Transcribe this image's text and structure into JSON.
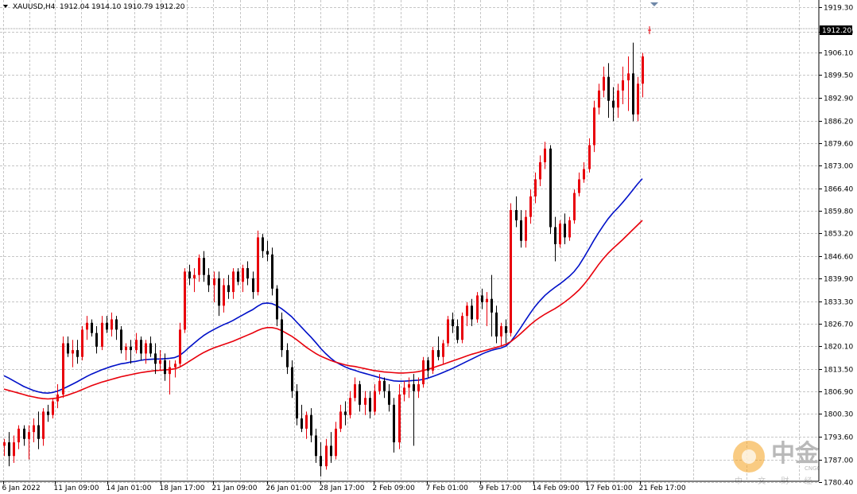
{
  "header": {
    "symbol": "XAUUSD,H4",
    "ohlc": "1912.04 1914.10 1910.79 1912.20"
  },
  "price_label": "1912.20",
  "watermark": {
    "logo_text": "中金网",
    "logo_sub": "CNGOLD.COM",
    "tagline": "中 文 财 经 新 媒 体"
  },
  "colors": {
    "bull": "#e8000b",
    "bear": "#000000",
    "ma_fast": "#0010c8",
    "ma_slow": "#e8000b",
    "grid": "#c6c6c6",
    "price_box": "#000000"
  },
  "chart_data": {
    "type": "candlestick",
    "symbol": "XAUUSD",
    "timeframe": "H4",
    "ylim": [
      1780.6,
      1921.5
    ],
    "y_ticks": [
      "1919.30",
      "1912.20",
      "1906.10",
      "1899.50",
      "1892.90",
      "1886.20",
      "1879.60",
      "1873.00",
      "1866.40",
      "1859.80",
      "1853.20",
      "1846.60",
      "1839.90",
      "1833.30",
      "1826.70",
      "1820.10",
      "1813.50",
      "1806.90",
      "1800.30",
      "1793.60",
      "1787.00",
      "1780.40"
    ],
    "x_ticks": [
      "6 Jan 2022",
      "11 Jan 09:00",
      "14 Jan 01:00",
      "18 Jan 17:00",
      "21 Jan 09:00",
      "26 Jan 01:00",
      "28 Jan 17:00",
      "2 Feb 09:00",
      "7 Feb 01:00",
      "9 Feb 17:00",
      "14 Feb 09:00",
      "17 Feb 01:00",
      "21 Feb 17:00"
    ],
    "current_price": 1912.2,
    "series": [
      {
        "name": "",
        "kind": "candles",
        "ohlc": [
          [
            1791,
            1793,
            1788,
            1792
          ],
          [
            1792,
            1795,
            1785,
            1788
          ],
          [
            1788,
            1794,
            1786,
            1792
          ],
          [
            1792,
            1797,
            1790,
            1796
          ],
          [
            1796,
            1797,
            1791,
            1793
          ],
          [
            1793,
            1797,
            1787,
            1795
          ],
          [
            1795,
            1799,
            1792,
            1797
          ],
          [
            1797,
            1801,
            1790,
            1793
          ],
          [
            1793,
            1802,
            1791,
            1801
          ],
          [
            1801,
            1803,
            1798,
            1800
          ],
          [
            1800,
            1805,
            1799,
            1804
          ],
          [
            1804,
            1809,
            1802,
            1806
          ],
          [
            1806,
            1823,
            1805,
            1821
          ],
          [
            1821,
            1823,
            1817,
            1818
          ],
          [
            1818,
            1822,
            1814,
            1819
          ],
          [
            1819,
            1822,
            1815,
            1817
          ],
          [
            1817,
            1826,
            1816,
            1825
          ],
          [
            1825,
            1829,
            1822,
            1827
          ],
          [
            1827,
            1828,
            1823,
            1824
          ],
          [
            1824,
            1826,
            1818,
            1820
          ],
          [
            1820,
            1829,
            1819,
            1827
          ],
          [
            1827,
            1829,
            1824,
            1825
          ],
          [
            1825,
            1830,
            1823,
            1828
          ],
          [
            1828,
            1829,
            1822,
            1825
          ],
          [
            1825,
            1826,
            1818,
            1819
          ],
          [
            1819,
            1821,
            1816,
            1820
          ],
          [
            1820,
            1822,
            1815,
            1819
          ],
          [
            1819,
            1824,
            1818,
            1822
          ],
          [
            1822,
            1823,
            1816,
            1818
          ],
          [
            1818,
            1822,
            1815,
            1821
          ],
          [
            1821,
            1823,
            1817,
            1818
          ],
          [
            1818,
            1821,
            1812,
            1815
          ],
          [
            1815,
            1819,
            1813,
            1816
          ],
          [
            1816,
            1818,
            1810,
            1812
          ],
          [
            1812,
            1816,
            1806,
            1814
          ],
          [
            1814,
            1816,
            1811,
            1815
          ],
          [
            1815,
            1827,
            1814,
            1825
          ],
          [
            1825,
            1843,
            1824,
            1842
          ],
          [
            1842,
            1844,
            1838,
            1840
          ],
          [
            1840,
            1843,
            1836,
            1841
          ],
          [
            1841,
            1847,
            1839,
            1846
          ],
          [
            1846,
            1848,
            1839,
            1841
          ],
          [
            1841,
            1843,
            1836,
            1838
          ],
          [
            1838,
            1842,
            1833,
            1840
          ],
          [
            1840,
            1842,
            1829,
            1832
          ],
          [
            1832,
            1840,
            1830,
            1838
          ],
          [
            1838,
            1841,
            1834,
            1836
          ],
          [
            1836,
            1843,
            1834,
            1842
          ],
          [
            1842,
            1843,
            1838,
            1839
          ],
          [
            1839,
            1844,
            1836,
            1843
          ],
          [
            1843,
            1845,
            1838,
            1840
          ],
          [
            1840,
            1842,
            1834,
            1836
          ],
          [
            1836,
            1854,
            1835,
            1852
          ],
          [
            1852,
            1853,
            1846,
            1848
          ],
          [
            1848,
            1851,
            1845,
            1847
          ],
          [
            1847,
            1849,
            1835,
            1837
          ],
          [
            1837,
            1838,
            1826,
            1828
          ],
          [
            1828,
            1830,
            1817,
            1819
          ],
          [
            1819,
            1821,
            1812,
            1814
          ],
          [
            1814,
            1816,
            1805,
            1807
          ],
          [
            1807,
            1809,
            1797,
            1799
          ],
          [
            1799,
            1803,
            1795,
            1796
          ],
          [
            1796,
            1801,
            1793,
            1800
          ],
          [
            1800,
            1802,
            1792,
            1794
          ],
          [
            1794,
            1796,
            1786,
            1788
          ],
          [
            1788,
            1792,
            1782,
            1785
          ],
          [
            1785,
            1793,
            1784,
            1791
          ],
          [
            1791,
            1795,
            1786,
            1788
          ],
          [
            1788,
            1798,
            1787,
            1796
          ],
          [
            1796,
            1803,
            1795,
            1801
          ],
          [
            1801,
            1804,
            1797,
            1800
          ],
          [
            1800,
            1807,
            1799,
            1805
          ],
          [
            1805,
            1811,
            1804,
            1809
          ],
          [
            1809,
            1810,
            1801,
            1803
          ],
          [
            1803,
            1807,
            1800,
            1805
          ],
          [
            1805,
            1807,
            1799,
            1801
          ],
          [
            1801,
            1809,
            1800,
            1807
          ],
          [
            1807,
            1812,
            1806,
            1810
          ],
          [
            1810,
            1811,
            1805,
            1807
          ],
          [
            1807,
            1809,
            1801,
            1803
          ],
          [
            1803,
            1805,
            1789,
            1792
          ],
          [
            1792,
            1809,
            1790,
            1806
          ],
          [
            1806,
            1810,
            1804,
            1808
          ],
          [
            1808,
            1811,
            1805,
            1809
          ],
          [
            1809,
            1812,
            1791,
            1807
          ],
          [
            1807,
            1811,
            1805,
            1809
          ],
          [
            1809,
            1817,
            1808,
            1816
          ],
          [
            1816,
            1817,
            1811,
            1813
          ],
          [
            1813,
            1820,
            1812,
            1819
          ],
          [
            1819,
            1823,
            1816,
            1817
          ],
          [
            1817,
            1822,
            1815,
            1821
          ],
          [
            1821,
            1829,
            1820,
            1828
          ],
          [
            1828,
            1830,
            1824,
            1826
          ],
          [
            1826,
            1828,
            1821,
            1822
          ],
          [
            1822,
            1830,
            1821,
            1829
          ],
          [
            1829,
            1833,
            1826,
            1832
          ],
          [
            1832,
            1834,
            1826,
            1828
          ],
          [
            1828,
            1836,
            1827,
            1835
          ],
          [
            1835,
            1837,
            1831,
            1833
          ],
          [
            1833,
            1836,
            1826,
            1834
          ],
          [
            1834,
            1841,
            1823,
            1830
          ],
          [
            1830,
            1832,
            1821,
            1823
          ],
          [
            1823,
            1827,
            1820,
            1826
          ],
          [
            1826,
            1828,
            1821,
            1824
          ],
          [
            1824,
            1862,
            1823,
            1860
          ],
          [
            1860,
            1864,
            1855,
            1857
          ],
          [
            1857,
            1860,
            1849,
            1851
          ],
          [
            1851,
            1860,
            1849,
            1858
          ],
          [
            1858,
            1866,
            1856,
            1864
          ],
          [
            1864,
            1871,
            1862,
            1869
          ],
          [
            1869,
            1876,
            1867,
            1874
          ],
          [
            1874,
            1880,
            1872,
            1878
          ],
          [
            1878,
            1879,
            1853,
            1855
          ],
          [
            1855,
            1858,
            1845,
            1850
          ],
          [
            1850,
            1857,
            1849,
            1856
          ],
          [
            1856,
            1859,
            1850,
            1852
          ],
          [
            1852,
            1858,
            1851,
            1857
          ],
          [
            1857,
            1866,
            1856,
            1865
          ],
          [
            1865,
            1871,
            1864,
            1869
          ],
          [
            1869,
            1874,
            1868,
            1872
          ],
          [
            1872,
            1881,
            1871,
            1879
          ],
          [
            1879,
            1892,
            1877,
            1890
          ],
          [
            1890,
            1897,
            1888,
            1895
          ],
          [
            1895,
            1902,
            1893,
            1899
          ],
          [
            1899,
            1903,
            1887,
            1892
          ],
          [
            1892,
            1896,
            1886,
            1890
          ],
          [
            1890,
            1897,
            1887,
            1895
          ],
          [
            1895,
            1902,
            1891,
            1898
          ],
          [
            1898,
            1905,
            1889,
            1900
          ],
          [
            1900,
            1909,
            1886,
            1888
          ],
          [
            1888,
            1899,
            1886,
            1897
          ],
          [
            1897,
            1906,
            1893,
            1905
          ]
        ],
        "color_up": "#e8000b",
        "color_down": "#000000"
      },
      {
        "name": "",
        "kind": "line",
        "color": "#0010c8",
        "values": [
          1811.5,
          1810.8,
          1810.0,
          1809.2,
          1808.4,
          1807.8,
          1807.2,
          1806.8,
          1806.5,
          1806.4,
          1806.6,
          1807.0,
          1807.6,
          1808.3,
          1809.0,
          1809.7,
          1810.5,
          1811.3,
          1812.0,
          1812.6,
          1813.2,
          1813.7,
          1814.2,
          1814.6,
          1815.0,
          1815.2,
          1815.5,
          1815.7,
          1816.0,
          1816.2,
          1816.3,
          1816.4,
          1816.4,
          1816.5,
          1816.6,
          1816.8,
          1817.4,
          1818.5,
          1819.8,
          1821.0,
          1822.2,
          1823.3,
          1824.2,
          1825.0,
          1825.7,
          1826.4,
          1827.0,
          1827.7,
          1828.5,
          1829.3,
          1830.1,
          1830.8,
          1831.8,
          1832.6,
          1832.8,
          1832.6,
          1832.0,
          1831.1,
          1830.0,
          1828.8,
          1827.3,
          1825.8,
          1824.3,
          1822.8,
          1821.2,
          1819.5,
          1818.0,
          1816.7,
          1815.6,
          1814.8,
          1814.1,
          1813.5,
          1813.1,
          1812.6,
          1812.2,
          1811.8,
          1811.4,
          1811.0,
          1810.6,
          1810.3,
          1810.0,
          1809.9,
          1809.9,
          1810.0,
          1810.1,
          1810.2,
          1810.4,
          1810.8,
          1811.3,
          1811.8,
          1812.4,
          1813.0,
          1813.6,
          1814.3,
          1815.0,
          1815.7,
          1816.4,
          1817.1,
          1817.8,
          1818.4,
          1818.9,
          1819.3,
          1819.6,
          1820.2,
          1821.5,
          1823.4,
          1825.5,
          1827.7,
          1829.8,
          1831.8,
          1833.5,
          1835.0,
          1836.2,
          1837.3,
          1838.3,
          1839.4,
          1840.6,
          1842.0,
          1843.8,
          1846.1,
          1848.5,
          1851.0,
          1853.3,
          1855.5,
          1857.5,
          1859.2,
          1860.7,
          1862.3,
          1864.0,
          1865.8,
          1867.6,
          1869.2
        ]
      },
      {
        "name": "",
        "kind": "line",
        "color": "#e8000b",
        "values": [
          1807.6,
          1807.2,
          1806.8,
          1806.4,
          1806.0,
          1805.6,
          1805.3,
          1805.0,
          1804.8,
          1804.7,
          1804.8,
          1805.0,
          1805.4,
          1805.8,
          1806.3,
          1806.8,
          1807.4,
          1808.0,
          1808.6,
          1809.1,
          1809.6,
          1810.0,
          1810.4,
          1810.8,
          1811.2,
          1811.5,
          1811.8,
          1812.1,
          1812.4,
          1812.6,
          1812.8,
          1813.0,
          1813.1,
          1813.2,
          1813.3,
          1813.5,
          1814.0,
          1814.8,
          1815.7,
          1816.6,
          1817.5,
          1818.3,
          1819.0,
          1819.6,
          1820.1,
          1820.6,
          1821.1,
          1821.6,
          1822.2,
          1822.8,
          1823.4,
          1824.0,
          1824.7,
          1825.3,
          1825.6,
          1825.6,
          1825.3,
          1824.7,
          1823.9,
          1823.1,
          1822.1,
          1821.0,
          1819.9,
          1818.9,
          1818.0,
          1817.2,
          1816.6,
          1816.0,
          1815.5,
          1815.1,
          1814.7,
          1814.4,
          1814.2,
          1813.9,
          1813.6,
          1813.3,
          1813.0,
          1812.8,
          1812.6,
          1812.5,
          1812.4,
          1812.3,
          1812.3,
          1812.4,
          1812.5,
          1812.7,
          1813.0,
          1813.4,
          1813.8,
          1814.3,
          1814.8,
          1815.3,
          1815.8,
          1816.3,
          1816.8,
          1817.3,
          1817.8,
          1818.2,
          1818.6,
          1819.0,
          1819.4,
          1819.8,
          1820.2,
          1820.7,
          1821.5,
          1822.6,
          1823.8,
          1825.1,
          1826.4,
          1827.6,
          1828.6,
          1829.5,
          1830.3,
          1831.1,
          1832.0,
          1833.0,
          1834.1,
          1835.3,
          1836.6,
          1838.2,
          1840.0,
          1842.0,
          1844.0,
          1845.8,
          1847.4,
          1848.8,
          1850.1,
          1851.4,
          1852.8,
          1854.2,
          1855.6,
          1857.0
        ]
      }
    ]
  }
}
